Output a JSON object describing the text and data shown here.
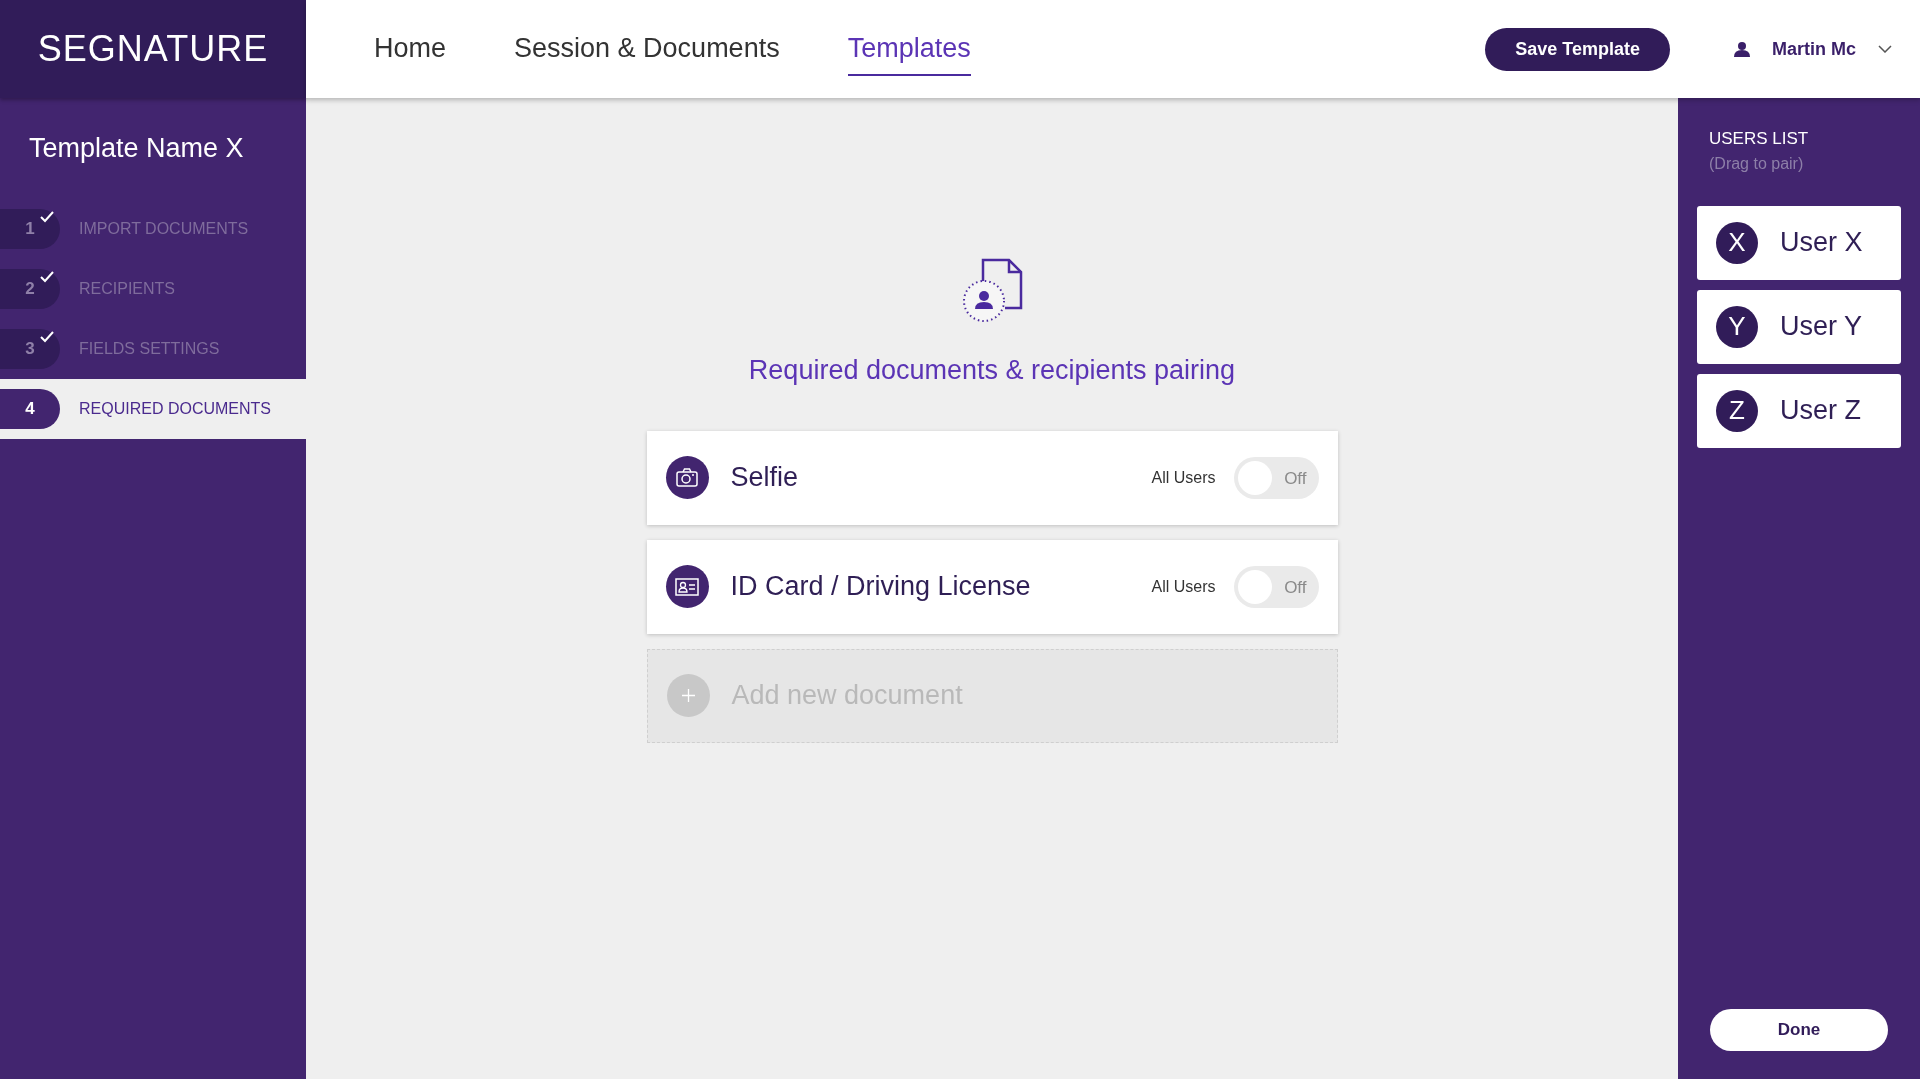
{
  "logo": "SEGNATURE",
  "nav": [
    {
      "label": "Home",
      "selected": false
    },
    {
      "label": "Session & Documents",
      "selected": false
    },
    {
      "label": "Templates",
      "selected": true
    }
  ],
  "save_button": "Save Template",
  "user": {
    "name": "Martin Mc"
  },
  "sidebar": {
    "title": "Template Name X",
    "steps": [
      {
        "number": "1",
        "label": "IMPORT DOCUMENTS",
        "done": true,
        "selected": false
      },
      {
        "number": "2",
        "label": "RECIPIENTS",
        "done": true,
        "selected": false
      },
      {
        "number": "3",
        "label": "FIELDS SETTINGS",
        "done": true,
        "selected": false
      },
      {
        "number": "4",
        "label": "REQUIRED DOCUMENTS",
        "done": false,
        "selected": true
      }
    ]
  },
  "main": {
    "heading": "Required documents & recipients pairing",
    "documents": [
      {
        "kind": "selfie",
        "name": "Selfie",
        "assignee": "All Users",
        "toggle_label": "Off",
        "on": false
      },
      {
        "kind": "id-card",
        "name": "ID Card / Driving License",
        "assignee": "All Users",
        "toggle_label": "Off",
        "on": false
      }
    ],
    "add_label": "Add new document"
  },
  "users_panel": {
    "title": "USERS LIST",
    "hint": "(Drag to pair)",
    "users": [
      {
        "initial": "X",
        "name": "User X"
      },
      {
        "initial": "Y",
        "name": "User Y"
      },
      {
        "initial": "Z",
        "name": "User Z"
      }
    ]
  },
  "done_button": "Done"
}
